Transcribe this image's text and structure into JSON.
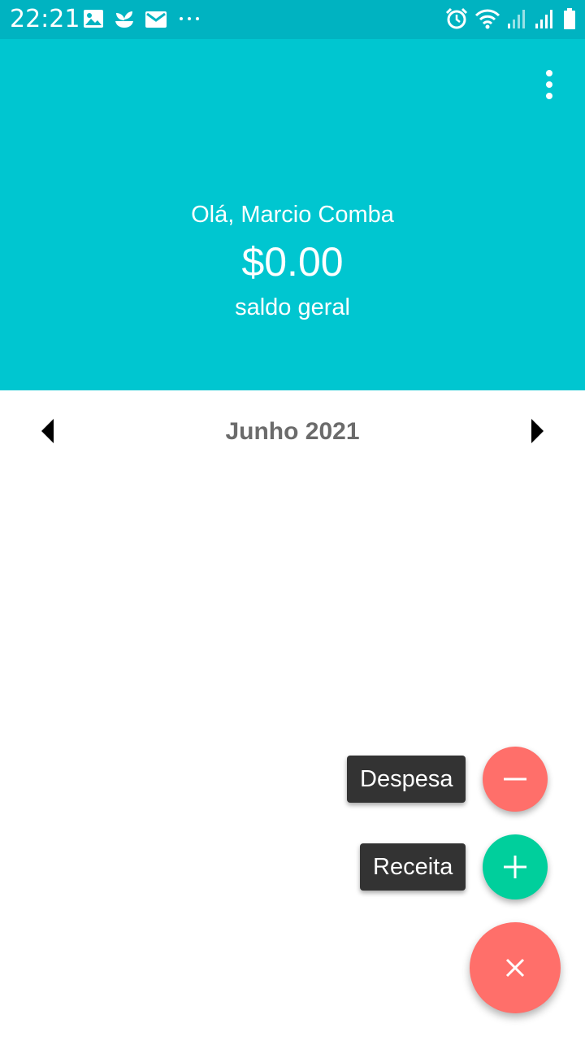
{
  "status_bar": {
    "time": "22:21",
    "color": "#00b3c1",
    "left_icons": [
      "image-icon",
      "sprout-icon",
      "mail-icon",
      "more-dots-icon"
    ],
    "right_icons": [
      "alarm-icon",
      "wifi-icon",
      "signal-icon",
      "signal-icon",
      "battery-icon"
    ]
  },
  "header": {
    "color": "#00c6d0",
    "greeting": "Olá, Marcio Comba",
    "balance": "$0.00",
    "balance_label": "saldo geral"
  },
  "month_nav": {
    "label": "Junho 2021"
  },
  "fab": {
    "expense_label": "Despesa",
    "income_label": "Receita",
    "expense_color": "#ff6f6a",
    "income_color": "#00cf9c",
    "main_color": "#ff6f6a"
  }
}
